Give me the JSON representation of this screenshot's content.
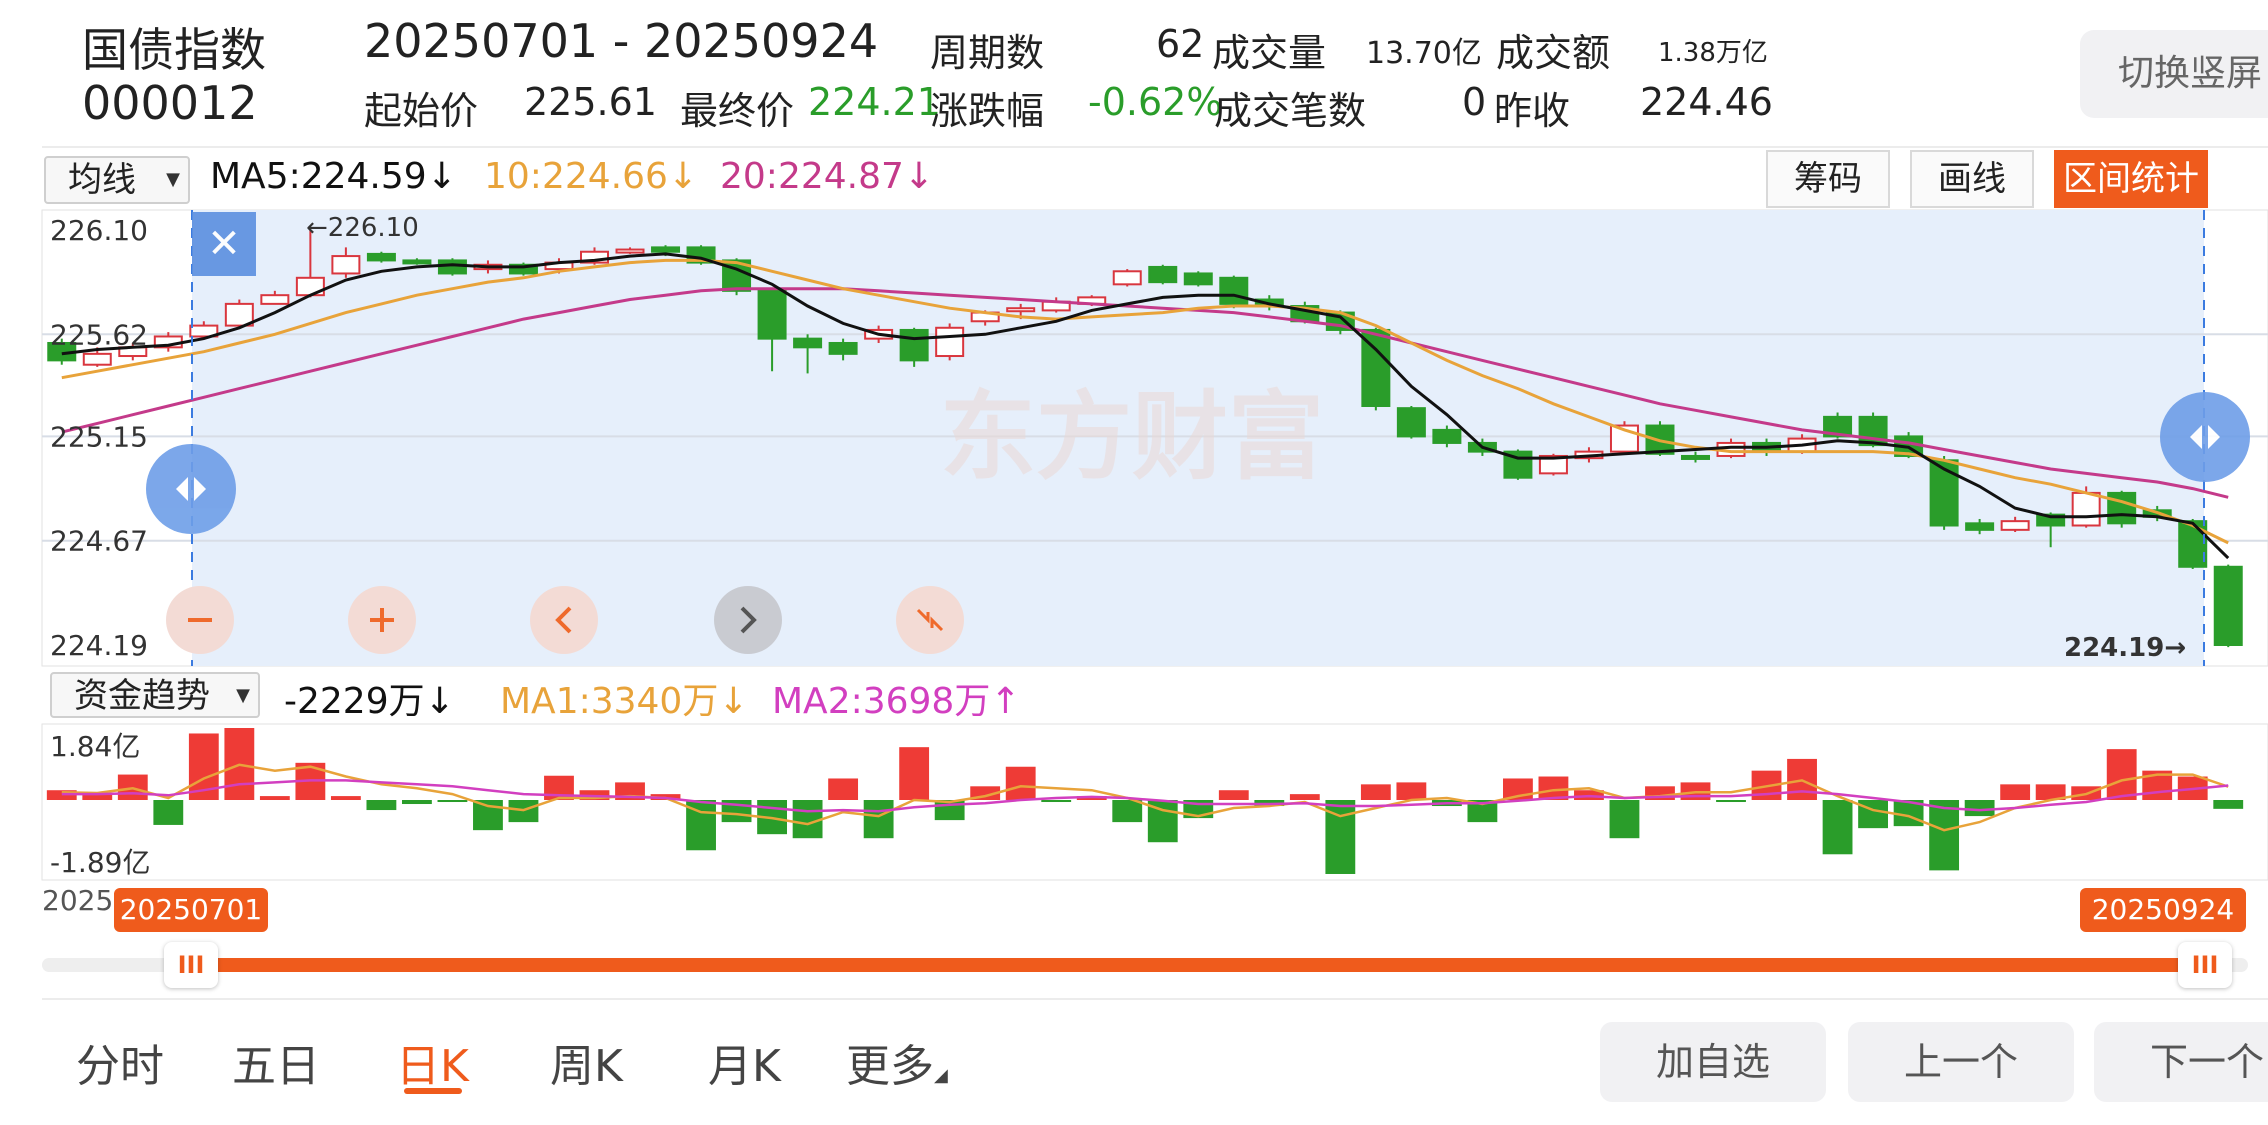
{
  "header": {
    "name": "国债指数",
    "code": "000012",
    "date_range": "20250701  - 20250924",
    "period_label": "周期数",
    "period_value": "62",
    "volume_label": "成交量",
    "volume_value": "13.70",
    "volume_unit": "亿",
    "amount_label": "成交额",
    "amount_value": "1.38",
    "amount_unit": "万亿",
    "open_label": "起始价",
    "open_value": "225.61",
    "close_label": "最终价",
    "close_value": "224.21",
    "change_label": "涨跌幅",
    "change_value": "-0.62%",
    "deals_label": "成交笔数",
    "deals_value": "0",
    "prev_label": "昨收",
    "prev_value": "224.46",
    "switch_button": "切换竖屏"
  },
  "ma_bar": {
    "select": "均线",
    "ma5": "MA5:224.59",
    "ma5_arrow": "↓",
    "ma10": "10:224.66",
    "ma10_arrow": "↓",
    "ma20": "20:224.87",
    "ma20_arrow": "↓",
    "tools": [
      "筹码",
      "画线",
      "区间统计"
    ]
  },
  "fund_bar": {
    "select": "资金趋势",
    "value": "-2229万",
    "value_arrow": "↓",
    "ma1": "MA1:3340万",
    "ma1_arrow": "↓",
    "ma2": "MA2:3698万",
    "ma2_arrow": "↑"
  },
  "range": {
    "axis_start_label": "2025",
    "start": "20250701",
    "end": "20250924",
    "handle_glyph": "III"
  },
  "tabs": [
    "分时",
    "五日",
    "日K",
    "周K",
    "月K",
    "更多"
  ],
  "more_arrow": "◢",
  "bottom_buttons": [
    "加自选",
    "上一个",
    "下一个"
  ],
  "watermark": "东方财富",
  "close_glyph": "✕",
  "colors": {
    "up": "#d9363e",
    "down": "#2a9d2a",
    "ma5": "#111111",
    "ma10": "#e8a33a",
    "ma20": "#c43a8a",
    "accent": "#ef5b1c",
    "selection": "#e6effb"
  },
  "chart_data": [
    {
      "type": "candlestick",
      "title": "",
      "y_ticks": [
        "226.10",
        "225.62",
        "225.15",
        "224.67",
        "224.19"
      ],
      "ylim": [
        224.19,
        226.1
      ],
      "high_marker": "←226.10",
      "low_marker": "224.19→",
      "ma_series": [
        {
          "name": "MA5"
        },
        {
          "name": "10"
        },
        {
          "name": "20"
        }
      ],
      "candles": [
        [
          225.58,
          225.5,
          225.6,
          225.48
        ],
        [
          225.48,
          225.53,
          225.56,
          225.47
        ],
        [
          225.52,
          225.56,
          225.58,
          225.5
        ],
        [
          225.56,
          225.61,
          225.63,
          225.54
        ],
        [
          225.61,
          225.66,
          225.68,
          225.6
        ],
        [
          225.66,
          225.76,
          225.78,
          225.65
        ],
        [
          225.76,
          225.8,
          225.82,
          225.76
        ],
        [
          225.8,
          225.88,
          226.1,
          225.79
        ],
        [
          225.9,
          225.98,
          226.02,
          225.88
        ],
        [
          225.99,
          225.96,
          226.0,
          225.95
        ],
        [
          225.96,
          225.95,
          225.97,
          225.94
        ],
        [
          225.96,
          225.9,
          225.97,
          225.89
        ],
        [
          225.92,
          225.94,
          225.96,
          225.9
        ],
        [
          225.94,
          225.9,
          225.95,
          225.89
        ],
        [
          225.92,
          225.95,
          225.97,
          225.9
        ],
        [
          225.95,
          226.0,
          226.02,
          225.94
        ],
        [
          226.0,
          226.01,
          226.02,
          225.99
        ],
        [
          226.02,
          226.0,
          226.03,
          225.98
        ],
        [
          226.02,
          225.95,
          226.03,
          225.94
        ],
        [
          225.96,
          225.82,
          225.97,
          225.8
        ],
        [
          225.82,
          225.6,
          225.83,
          225.45
        ],
        [
          225.6,
          225.56,
          225.62,
          225.44
        ],
        [
          225.58,
          225.53,
          225.6,
          225.5
        ],
        [
          225.6,
          225.64,
          225.66,
          225.58
        ],
        [
          225.64,
          225.5,
          225.65,
          225.47
        ],
        [
          225.52,
          225.65,
          225.67,
          225.5
        ],
        [
          225.68,
          225.72,
          225.73,
          225.66
        ],
        [
          225.73,
          225.74,
          225.76,
          225.69
        ],
        [
          225.73,
          225.77,
          225.79,
          225.72
        ],
        [
          225.76,
          225.79,
          225.8,
          225.75
        ],
        [
          225.85,
          225.91,
          225.92,
          225.84
        ],
        [
          225.93,
          225.86,
          225.94,
          225.85
        ],
        [
          225.9,
          225.85,
          225.91,
          225.84
        ],
        [
          225.88,
          225.76,
          225.89,
          225.74
        ],
        [
          225.78,
          225.75,
          225.8,
          225.73
        ],
        [
          225.75,
          225.68,
          225.77,
          225.67
        ],
        [
          225.72,
          225.64,
          225.73,
          225.62
        ],
        [
          225.64,
          225.29,
          225.65,
          225.27
        ],
        [
          225.28,
          225.15,
          225.29,
          225.14
        ],
        [
          225.18,
          225.12,
          225.2,
          225.1
        ],
        [
          225.12,
          225.08,
          225.14,
          225.06
        ],
        [
          225.08,
          224.96,
          225.09,
          224.95
        ],
        [
          224.98,
          225.06,
          225.07,
          224.97
        ],
        [
          225.05,
          225.08,
          225.1,
          225.03
        ],
        [
          225.08,
          225.2,
          225.22,
          225.07
        ],
        [
          225.2,
          225.07,
          225.22,
          225.06
        ],
        [
          225.06,
          225.05,
          225.08,
          225.03
        ],
        [
          225.06,
          225.12,
          225.14,
          225.05
        ],
        [
          225.12,
          225.08,
          225.14,
          225.06
        ],
        [
          225.08,
          225.14,
          225.16,
          225.07
        ],
        [
          225.24,
          225.15,
          225.26,
          225.14
        ],
        [
          225.24,
          225.11,
          225.26,
          225.1
        ],
        [
          225.15,
          225.06,
          225.17,
          225.05
        ],
        [
          225.04,
          224.74,
          225.06,
          224.72
        ],
        [
          224.75,
          224.72,
          224.77,
          224.7
        ],
        [
          224.72,
          224.76,
          224.78,
          224.71
        ],
        [
          224.79,
          224.74,
          224.8,
          224.64
        ],
        [
          224.74,
          224.89,
          224.92,
          224.73
        ],
        [
          224.89,
          224.75,
          224.9,
          224.73
        ],
        [
          224.81,
          224.78,
          224.83,
          224.76
        ],
        [
          224.76,
          224.55,
          224.77,
          224.54
        ],
        [
          224.55,
          224.19,
          224.56,
          224.18
        ]
      ],
      "ma5": [
        225.53,
        225.55,
        225.56,
        225.57,
        225.6,
        225.65,
        225.72,
        225.8,
        225.87,
        225.91,
        225.93,
        225.94,
        225.93,
        225.93,
        225.95,
        225.96,
        225.98,
        225.99,
        225.97,
        225.92,
        225.85,
        225.75,
        225.67,
        225.62,
        225.6,
        225.61,
        225.62,
        225.65,
        225.68,
        225.73,
        225.76,
        225.79,
        225.8,
        225.8,
        225.76,
        225.73,
        225.7,
        225.55,
        225.38,
        225.25,
        225.1,
        225.05,
        225.05,
        225.06,
        225.07,
        225.08,
        225.09,
        225.1,
        225.1,
        225.11,
        225.13,
        225.12,
        225.1,
        225.0,
        224.92,
        224.82,
        224.78,
        224.78,
        224.79,
        224.78,
        224.75,
        224.59
      ],
      "ma10": [
        225.42,
        225.45,
        225.48,
        225.51,
        225.54,
        225.58,
        225.62,
        225.67,
        225.72,
        225.76,
        225.8,
        225.83,
        225.86,
        225.88,
        225.91,
        225.93,
        225.95,
        225.96,
        225.96,
        225.95,
        225.91,
        225.87,
        225.83,
        225.8,
        225.77,
        225.74,
        225.72,
        225.7,
        225.69,
        225.7,
        225.71,
        225.72,
        225.74,
        225.75,
        225.75,
        225.74,
        225.72,
        225.66,
        225.58,
        225.5,
        225.43,
        225.37,
        225.3,
        225.24,
        225.18,
        225.13,
        225.1,
        225.08,
        225.08,
        225.08,
        225.08,
        225.08,
        225.07,
        225.04,
        225.0,
        224.96,
        224.93,
        224.89,
        224.85,
        224.8,
        224.74,
        224.66
      ],
      "ma20": [
        225.17,
        225.21,
        225.25,
        225.29,
        225.33,
        225.37,
        225.41,
        225.45,
        225.49,
        225.53,
        225.57,
        225.61,
        225.65,
        225.69,
        225.72,
        225.75,
        225.78,
        225.8,
        225.82,
        225.83,
        225.83,
        225.83,
        225.83,
        225.82,
        225.81,
        225.8,
        225.79,
        225.78,
        225.77,
        225.76,
        225.75,
        225.74,
        225.73,
        225.72,
        225.7,
        225.68,
        225.66,
        225.62,
        225.58,
        225.54,
        225.5,
        225.46,
        225.42,
        225.38,
        225.34,
        225.3,
        225.27,
        225.24,
        225.21,
        225.18,
        225.16,
        225.14,
        225.12,
        225.09,
        225.06,
        225.03,
        225.0,
        224.98,
        224.96,
        224.94,
        224.91,
        224.87
      ]
    },
    {
      "type": "bar",
      "title": "",
      "y_ticks": [
        "1.84亿",
        "-1.89亿"
      ],
      "ylim": [
        -1.89,
        1.84
      ],
      "unit": "亿",
      "values": [
        0.25,
        0.15,
        0.65,
        -0.62,
        1.7,
        1.84,
        0.1,
        0.95,
        0.1,
        -0.25,
        -0.1,
        -0.05,
        -0.75,
        -0.55,
        0.62,
        0.25,
        0.45,
        0.15,
        -1.25,
        -0.55,
        -0.85,
        -0.95,
        0.55,
        -0.95,
        1.35,
        -0.5,
        0.35,
        0.85,
        -0.05,
        0.1,
        -0.55,
        -1.05,
        -0.45,
        0.25,
        -0.15,
        0.15,
        -1.84,
        0.4,
        0.45,
        -0.15,
        -0.55,
        0.55,
        0.6,
        0.25,
        -0.95,
        0.35,
        0.45,
        -0.05,
        0.75,
        1.05,
        -1.35,
        -0.7,
        -0.65,
        -1.75,
        -0.4,
        0.4,
        0.4,
        0.35,
        1.3,
        0.75,
        0.6,
        -0.22
      ],
      "ma1": [
        0.2,
        0.18,
        0.3,
        0.05,
        0.55,
        0.9,
        0.75,
        0.85,
        0.6,
        0.4,
        0.3,
        0.15,
        -0.15,
        -0.25,
        0.05,
        0.05,
        0.1,
        0.05,
        -0.3,
        -0.35,
        -0.45,
        -0.6,
        -0.3,
        -0.4,
        0.0,
        -0.05,
        0.1,
        0.35,
        0.3,
        0.25,
        0.05,
        -0.25,
        -0.4,
        -0.2,
        -0.15,
        -0.05,
        -0.4,
        -0.2,
        0.0,
        0.05,
        -0.1,
        0.1,
        0.25,
        0.3,
        0.05,
        0.1,
        0.2,
        0.2,
        0.35,
        0.5,
        0.1,
        -0.25,
        -0.4,
        -0.75,
        -0.55,
        -0.2,
        0.0,
        0.15,
        0.5,
        0.65,
        0.65,
        0.34
      ],
      "ma2": [
        0.15,
        0.15,
        0.17,
        0.12,
        0.25,
        0.4,
        0.45,
        0.5,
        0.5,
        0.45,
        0.4,
        0.35,
        0.25,
        0.15,
        0.12,
        0.1,
        0.08,
        0.05,
        -0.05,
        -0.12,
        -0.2,
        -0.28,
        -0.25,
        -0.28,
        -0.18,
        -0.12,
        -0.08,
        0.0,
        0.05,
        0.08,
        0.05,
        -0.02,
        -0.1,
        -0.1,
        -0.1,
        -0.08,
        -0.15,
        -0.15,
        -0.12,
        -0.08,
        -0.08,
        -0.02,
        0.05,
        0.1,
        0.05,
        0.08,
        0.1,
        0.1,
        0.15,
        0.22,
        0.15,
        0.05,
        -0.05,
        -0.2,
        -0.25,
        -0.2,
        -0.12,
        -0.05,
        0.1,
        0.2,
        0.28,
        0.37
      ]
    }
  ]
}
